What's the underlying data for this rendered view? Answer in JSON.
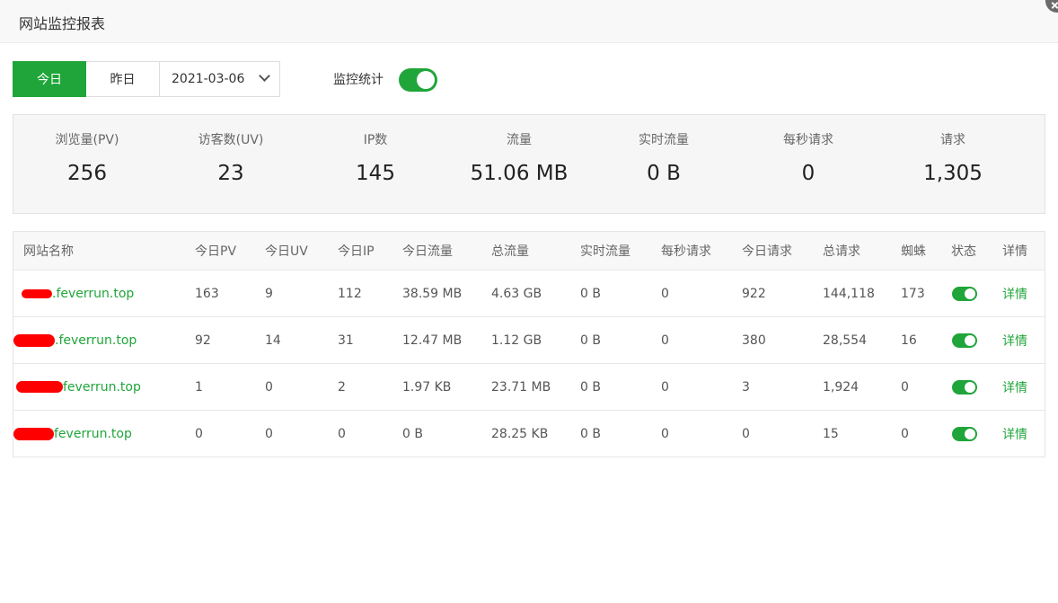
{
  "window": {
    "title": "网站监控报表"
  },
  "toolbar": {
    "today": "今日",
    "yesterday": "昨日",
    "date": "2021-03-06",
    "monitor_label": "监控统计",
    "monitor_enabled": true
  },
  "stats": [
    {
      "label": "浏览量(PV)",
      "value": "256"
    },
    {
      "label": "访客数(UV)",
      "value": "23"
    },
    {
      "label": "IP数",
      "value": "145"
    },
    {
      "label": "流量",
      "value": "51.06 MB"
    },
    {
      "label": "实时流量",
      "value": "0 B"
    },
    {
      "label": "每秒请求",
      "value": "0"
    },
    {
      "label": "请求",
      "value": "1,305"
    }
  ],
  "table": {
    "headers": [
      "网站名称",
      "今日PV",
      "今日UV",
      "今日IP",
      "今日流量",
      "总流量",
      "实时流量",
      "每秒请求",
      "今日请求",
      "总请求",
      "蜘蛛",
      "状态",
      "详情"
    ],
    "rows": [
      {
        "site": ".feverrun.top",
        "pv": "163",
        "uv": "9",
        "ip": "112",
        "today_traffic": "38.59 MB",
        "total_traffic": "4.63 GB",
        "realtime": "0 B",
        "qps": "0",
        "today_req": "922",
        "total_req": "144,118",
        "spider": "173",
        "status_on": true,
        "detail": "详情"
      },
      {
        "site": ".feverrun.top",
        "pv": "92",
        "uv": "14",
        "ip": "31",
        "today_traffic": "12.47 MB",
        "total_traffic": "1.12 GB",
        "realtime": "0 B",
        "qps": "0",
        "today_req": "380",
        "total_req": "28,554",
        "spider": "16",
        "status_on": true,
        "detail": "详情"
      },
      {
        "site": "feverrun.top",
        "pv": "1",
        "uv": "0",
        "ip": "2",
        "today_traffic": "1.97 KB",
        "total_traffic": "23.71 MB",
        "realtime": "0 B",
        "qps": "0",
        "today_req": "3",
        "total_req": "1,924",
        "spider": "0",
        "status_on": true,
        "detail": "详情"
      },
      {
        "site": "feverrun.top",
        "pv": "0",
        "uv": "0",
        "ip": "0",
        "today_traffic": "0 B",
        "total_traffic": "28.25 KB",
        "realtime": "0 B",
        "qps": "0",
        "today_req": "0",
        "total_req": "15",
        "spider": "0",
        "status_on": true,
        "detail": "详情"
      }
    ]
  },
  "colors": {
    "accent": "#20a53a",
    "redaction": "#ff0000"
  }
}
